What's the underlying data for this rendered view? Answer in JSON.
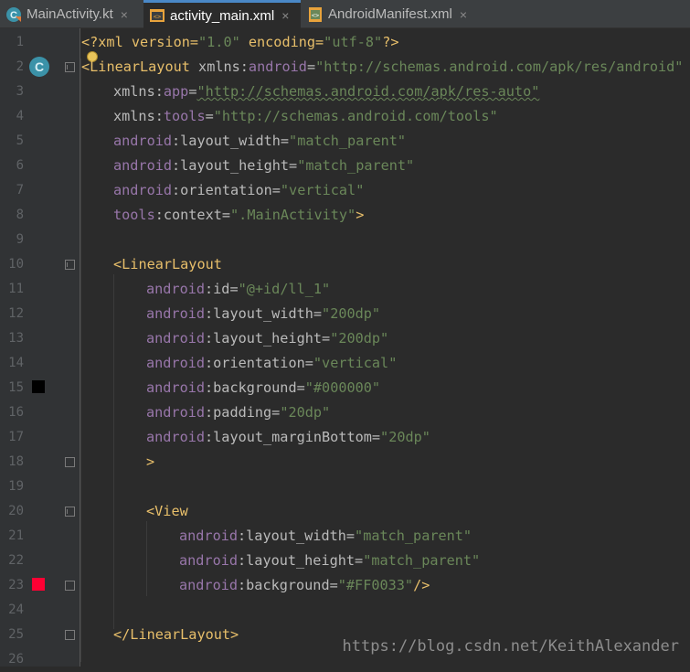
{
  "tabs": [
    {
      "label": "MainActivity.kt",
      "icon": "kotlin-class-icon",
      "active": false
    },
    {
      "label": "activity_main.xml",
      "icon": "layout-xml-icon",
      "active": true
    },
    {
      "label": "AndroidManifest.xml",
      "icon": "manifest-icon",
      "active": false
    }
  ],
  "close_glyph": "×",
  "gutter": {
    "line_numbers": [
      "1",
      "2",
      "3",
      "4",
      "5",
      "6",
      "7",
      "8",
      "9",
      "10",
      "11",
      "12",
      "13",
      "14",
      "15",
      "16",
      "17",
      "18",
      "19",
      "20",
      "21",
      "22",
      "23",
      "24",
      "25",
      "26"
    ],
    "class_badge": "C",
    "swatch_colors": {
      "line15": "#000000",
      "line23": "#FF0033"
    }
  },
  "code": {
    "l1": {
      "open": "<?xml version=",
      "v1": "\"1.0\"",
      "mid": " encoding=",
      "v2": "\"utf-8\"",
      "close": "?>"
    },
    "l2": {
      "open": "<",
      "tag": "LinearLayout",
      "sp": " ",
      "attr": "xmlns:",
      "ns": "android",
      "eq": "=",
      "val": "\"http://schemas.android.com/apk/res/android\""
    },
    "l3": {
      "attr": "xmlns:",
      "ns": "app",
      "eq": "=",
      "val": "\"http://schemas.android.com/apk/res-auto\""
    },
    "l4": {
      "attr": "xmlns:",
      "ns": "tools",
      "eq": "=",
      "val": "\"http://schemas.android.com/tools\""
    },
    "l5": {
      "ns": "android",
      "attr": ":layout_width",
      "eq": "=",
      "val": "\"match_parent\""
    },
    "l6": {
      "ns": "android",
      "attr": ":layout_height",
      "eq": "=",
      "val": "\"match_parent\""
    },
    "l7": {
      "ns": "android",
      "attr": ":orientation",
      "eq": "=",
      "val": "\"vertical\""
    },
    "l8": {
      "ns": "tools",
      "attr": ":context",
      "eq": "=",
      "val": "\".MainActivity\"",
      "close": ">"
    },
    "l10": {
      "open": "<",
      "tag": "LinearLayout"
    },
    "l11": {
      "ns": "android",
      "attr": ":id",
      "eq": "=",
      "val": "\"@+id/ll_1\""
    },
    "l12": {
      "ns": "android",
      "attr": ":layout_width",
      "eq": "=",
      "val": "\"200dp\""
    },
    "l13": {
      "ns": "android",
      "attr": ":layout_height",
      "eq": "=",
      "val": "\"200dp\""
    },
    "l14": {
      "ns": "android",
      "attr": ":orientation",
      "eq": "=",
      "val": "\"vertical\""
    },
    "l15": {
      "ns": "android",
      "attr": ":background",
      "eq": "=",
      "val": "\"#000000\""
    },
    "l16": {
      "ns": "android",
      "attr": ":padding",
      "eq": "=",
      "val": "\"20dp\""
    },
    "l17": {
      "ns": "android",
      "attr": ":layout_marginBottom",
      "eq": "=",
      "val": "\"20dp\""
    },
    "l18": {
      "close": ">"
    },
    "l20": {
      "open": "<",
      "tag": "View"
    },
    "l21": {
      "ns": "android",
      "attr": ":layout_width",
      "eq": "=",
      "val": "\"match_parent\""
    },
    "l22": {
      "ns": "android",
      "attr": ":layout_height",
      "eq": "=",
      "val": "\"match_parent\""
    },
    "l23": {
      "ns": "android",
      "attr": ":background",
      "eq": "=",
      "val": "\"#FF0033\"",
      "close": "/>"
    },
    "l25": {
      "open": "</",
      "tag": "LinearLayout",
      "close": ">"
    }
  },
  "watermark": "https://blog.csdn.net/KeithAlexander"
}
